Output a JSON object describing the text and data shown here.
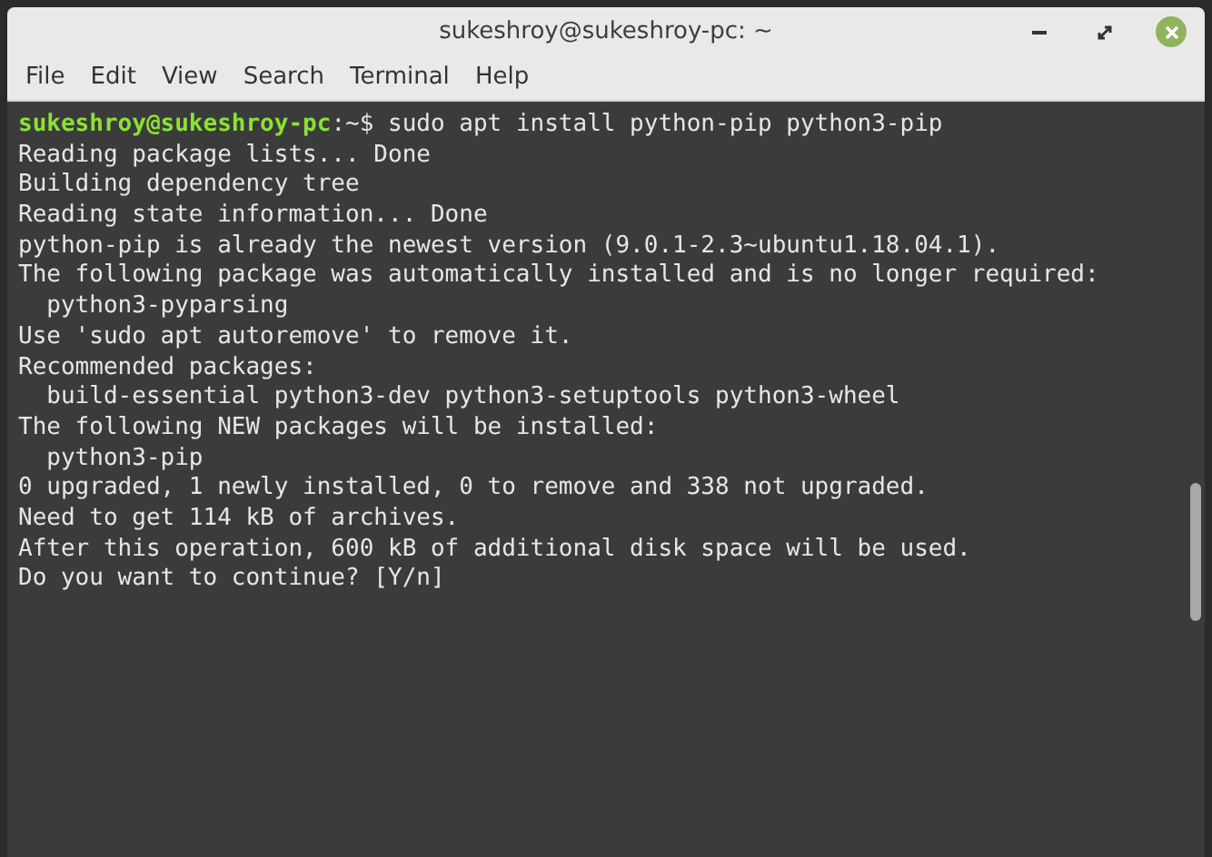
{
  "window": {
    "title": "sukeshroy@sukeshroy-pc: ~"
  },
  "menu": [
    {
      "label": "File"
    },
    {
      "label": "Edit"
    },
    {
      "label": "View"
    },
    {
      "label": "Search"
    },
    {
      "label": "Terminal"
    },
    {
      "label": "Help"
    }
  ],
  "terminal": {
    "lines": [
      {
        "kind": "prompt",
        "user_host": "sukeshroy@sukeshroy-pc",
        "separator": ":",
        "path": "~$",
        "command": " sudo apt install python-pip python3-pip"
      },
      {
        "kind": "output",
        "text": "Reading package lists... Done"
      },
      {
        "kind": "output",
        "text": "Building dependency tree"
      },
      {
        "kind": "output",
        "text": "Reading state information... Done"
      },
      {
        "kind": "output",
        "text": "python-pip is already the newest version (9.0.1-2.3~ubuntu1.18.04.1)."
      },
      {
        "kind": "output",
        "text": "The following package was automatically installed and is no longer required:"
      },
      {
        "kind": "output",
        "text": "  python3-pyparsing"
      },
      {
        "kind": "output",
        "text": "Use 'sudo apt autoremove' to remove it."
      },
      {
        "kind": "output",
        "text": "Recommended packages:"
      },
      {
        "kind": "output",
        "text": "  build-essential python3-dev python3-setuptools python3-wheel"
      },
      {
        "kind": "output",
        "text": "The following NEW packages will be installed:"
      },
      {
        "kind": "output",
        "text": "  python3-pip"
      },
      {
        "kind": "output",
        "text": "0 upgraded, 1 newly installed, 0 to remove and 338 not upgraded."
      },
      {
        "kind": "output",
        "text": "Need to get 114 kB of archives."
      },
      {
        "kind": "output",
        "text": "After this operation, 600 kB of additional disk space will be used."
      },
      {
        "kind": "output",
        "text": "Do you want to continue? [Y/n]"
      }
    ]
  }
}
